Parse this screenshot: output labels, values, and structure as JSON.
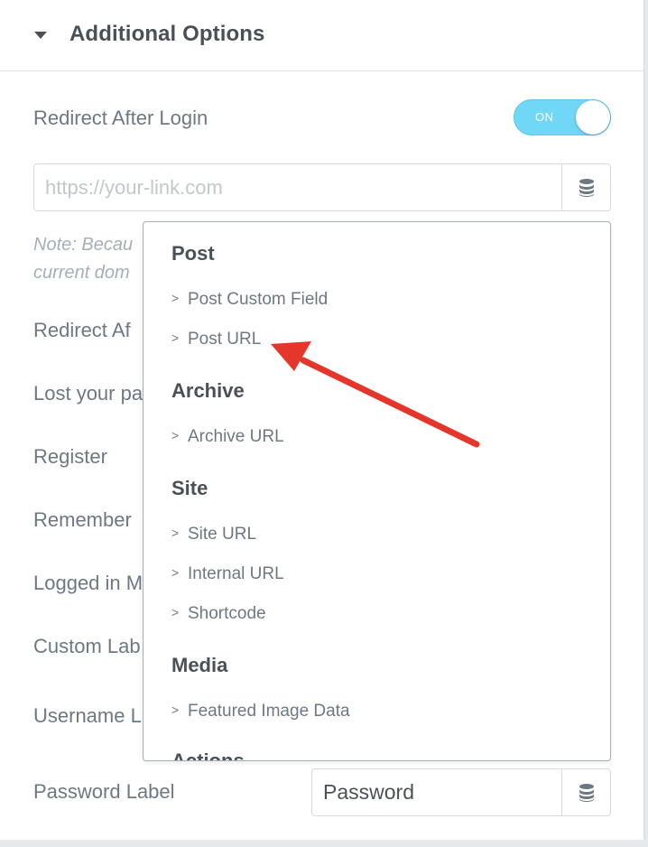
{
  "section": {
    "title": "Additional Options"
  },
  "redirect_login": {
    "label": "Redirect After Login",
    "toggle_text": "ON"
  },
  "url_input": {
    "value": "",
    "placeholder": "https://your-link.com"
  },
  "note": {
    "line1": "Note: Becau",
    "line2": "current dom"
  },
  "rows": {
    "redirect_after": "Redirect Af",
    "lost_password": "Lost your pa",
    "register": "Register",
    "remember": "Remember",
    "logged_in": "Logged in M",
    "custom_label": "Custom Lab",
    "username_label": "Username L",
    "password_label": "Password Label"
  },
  "password_input": {
    "value": "Password"
  },
  "dropdown": {
    "groups": [
      {
        "title": "Post",
        "items": [
          "Post Custom Field",
          "Post URL"
        ]
      },
      {
        "title": "Archive",
        "items": [
          "Archive URL"
        ]
      },
      {
        "title": "Site",
        "items": [
          "Site URL",
          "Internal URL",
          "Shortcode"
        ]
      },
      {
        "title": "Media",
        "items": [
          "Featured Image Data"
        ]
      },
      {
        "title": "Actions",
        "items": []
      }
    ],
    "chevron": ">"
  },
  "icons": {
    "caret": "caret-down-icon",
    "database": "database-icon",
    "annotation": "red-arrow-annotation"
  },
  "colors": {
    "toggle_on": "#71d7f7",
    "annotation": "#e5362b",
    "text": "#495157",
    "muted": "#6d7882"
  }
}
